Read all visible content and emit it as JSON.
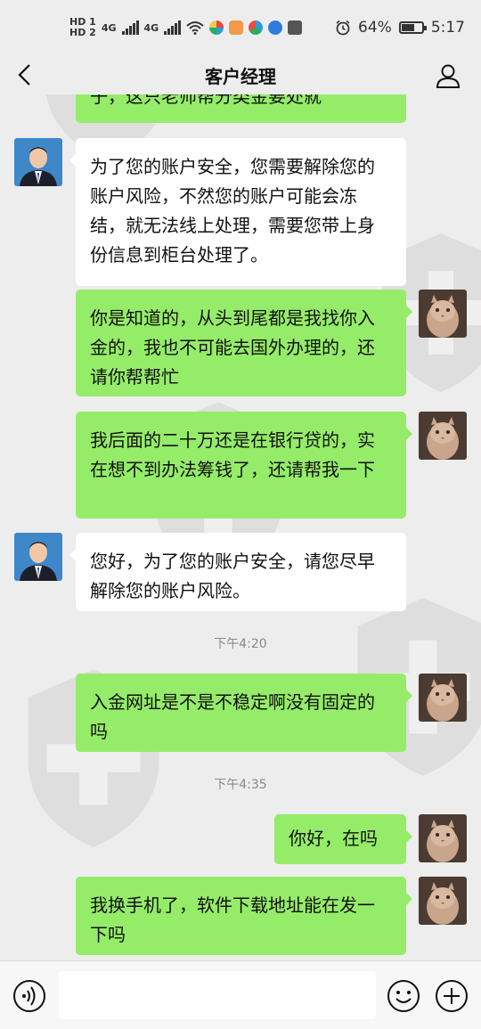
{
  "status_bar": {
    "hd1": "HD 1",
    "hd2": "HD 2",
    "net1": "4G",
    "net2": "4G",
    "battery_percent_text": "64%",
    "battery_level": 0.64,
    "time": "5:17"
  },
  "header": {
    "title": "客户经理"
  },
  "messages": [
    {
      "side": "out",
      "text": "子，这只老师帮分类金要处就"
    },
    {
      "side": "in",
      "text": "为了您的账户安全，您需要解除您的账户风险，不然您的账户可能会冻结，就无法线上处理，需要您带上身份信息到柜台处理了。"
    },
    {
      "side": "out",
      "text": "你是知道的，从头到尾都是我找你入金的，我也不可能去国外办理的，还请你帮帮忙"
    },
    {
      "side": "out",
      "text": "我后面的二十万还是在银行贷的，实在想不到办法筹钱了，还请帮我一下"
    },
    {
      "side": "in",
      "text": "您好，为了您的账户安全，请您尽早解除您的账户风险。"
    },
    {
      "side": "out",
      "text": "入金网址是不是不稳定啊没有固定的吗"
    },
    {
      "side": "out",
      "text": "你好，在吗"
    },
    {
      "side": "out",
      "text": "我换手机了，软件下载地址能在发一下吗"
    }
  ],
  "timestamps": [
    "下午4:20",
    "下午4:35"
  ],
  "input": {
    "value": "",
    "placeholder": ""
  },
  "colors": {
    "background": "#ededed",
    "outgoing_bubble": "#95ec69",
    "incoming_bubble": "#ffffff"
  },
  "icons": [
    "back-arrow-icon",
    "user-profile-icon",
    "voice-icon",
    "emoji-icon",
    "plus-icon",
    "alarm-icon",
    "wifi-icon",
    "battery-icon"
  ]
}
